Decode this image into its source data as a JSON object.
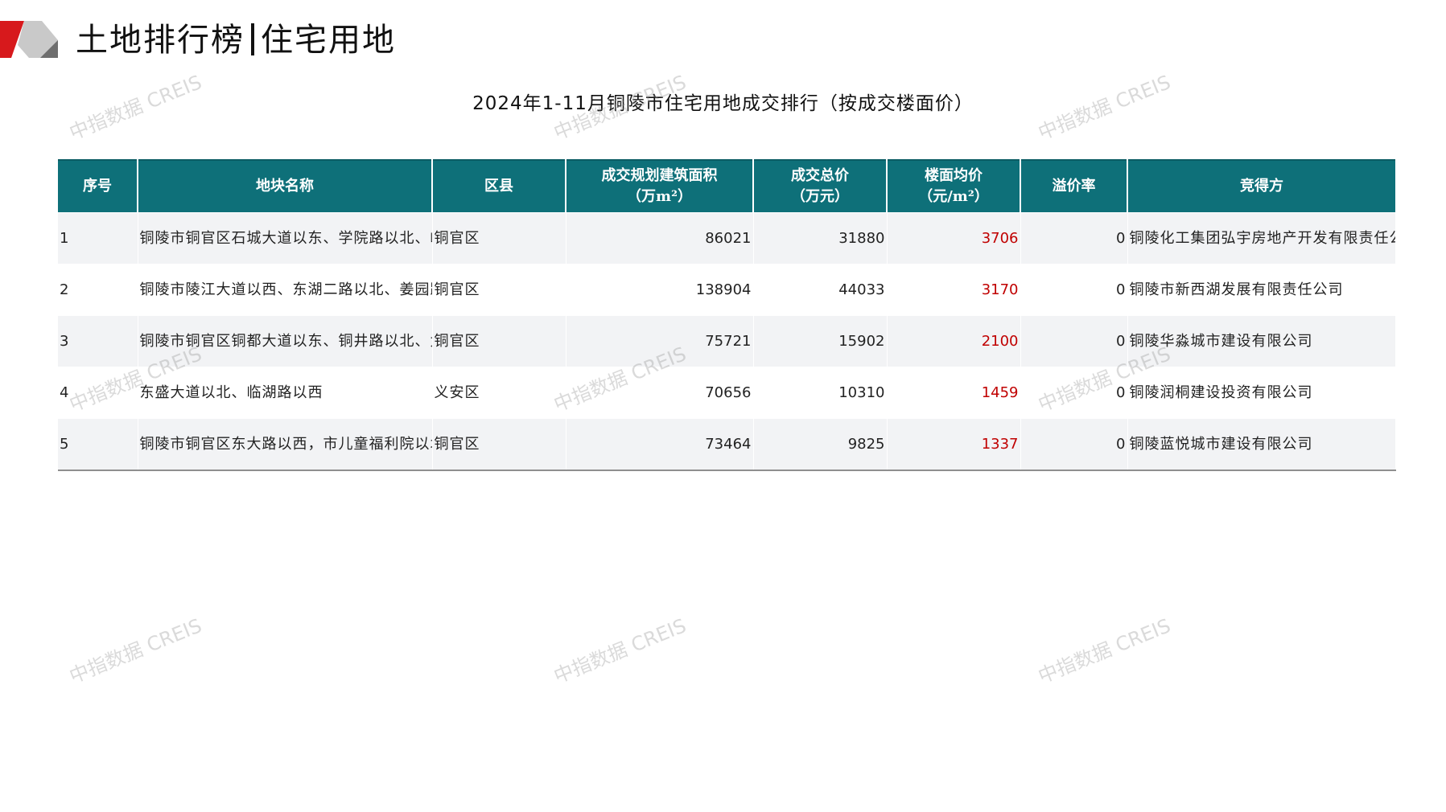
{
  "brand": {
    "accent": "#d7191c",
    "grey": "#c9c9c9",
    "header_bg": "#0e7079",
    "price_color": "#c00000"
  },
  "page": {
    "title_left": "土地排行榜",
    "title_right": "住宅用地"
  },
  "table": {
    "title": "2024年1-11月铜陵市住宅用地成交排行（按成交楼面价）",
    "headers": {
      "no": "序号",
      "name": "地块名称",
      "district": "区县",
      "area_l1": "成交规划建筑面积",
      "area_l2": "（万m²）",
      "total_l1": "成交总价",
      "total_l2": "（万元）",
      "price_l1": "楼面均价",
      "price_l2": "（元/m²）",
      "premium": "溢价率",
      "winner": "竞得方"
    },
    "rows": [
      {
        "no": "1",
        "name": "铜陵市铜官区石城大道以东、学院路以北、峰南苑苑路以南",
        "district": "铜官区",
        "area": "86021",
        "total": "31880",
        "price": "3706",
        "premium": "0",
        "winner": "铜陵化工集团弘宇房地产开发有限责任公司"
      },
      {
        "no": "2",
        "name": "铜陵市陵江大道以西、东湖二路以北、姜园路以东、规划二路以南",
        "district": "铜官区",
        "area": "138904",
        "total": "44033",
        "price": "3170",
        "premium": "0",
        "winner": "铜陵市新西湖发展有限责任公司"
      },
      {
        "no": "3",
        "name": "铜陵市铜官区铜都大道以东、铜井路以北、太平湖路以南",
        "district": "铜官区",
        "area": "75721",
        "total": "15902",
        "price": "2100",
        "premium": "0",
        "winner": "铜陵华淼城市建设有限公司"
      },
      {
        "no": "4",
        "name": "东盛大道以北、临湖路以西",
        "district": "义安区",
        "area": "70656",
        "total": "10310",
        "price": "1459",
        "premium": "0",
        "winner": "铜陵润桐建设投资有限公司"
      },
      {
        "no": "5",
        "name": "铜陵市铜官区东大路以西，市儿童福利院以北",
        "district": "铜官区",
        "area": "73464",
        "total": "9825",
        "price": "1337",
        "premium": "0",
        "winner": "铜陵蓝悦城市建设有限公司"
      }
    ]
  },
  "watermark": {
    "text": "中指数据 CREIS"
  }
}
